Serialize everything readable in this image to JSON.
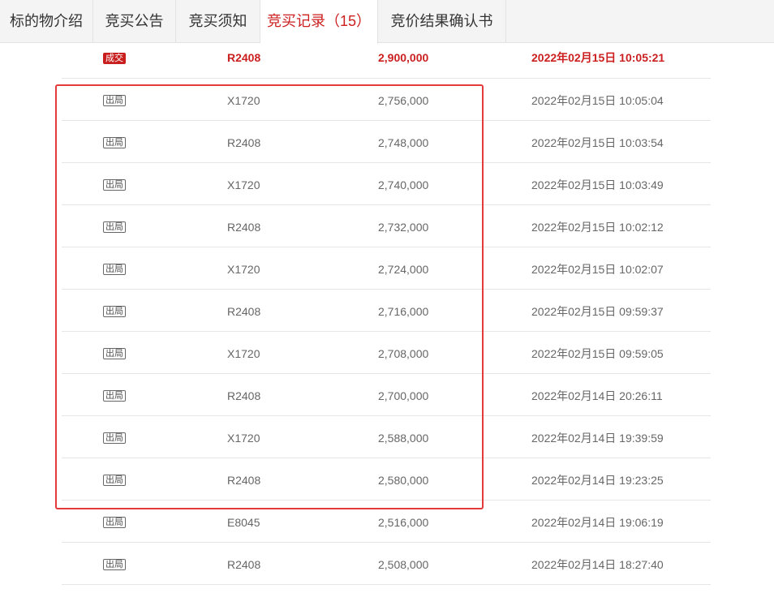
{
  "tabs": [
    {
      "label": "标的物介绍",
      "active": false
    },
    {
      "label": "竞买公告",
      "active": false
    },
    {
      "label": "竞买须知",
      "active": false
    },
    {
      "label": "竞买记录（15）",
      "active": true
    },
    {
      "label": "竞价结果确认书",
      "active": false
    }
  ],
  "records": [
    {
      "status": "成交",
      "bidder": "R2408",
      "price": "2,900,000",
      "time": "2022年02月15日 10:05:21"
    },
    {
      "status": "出局",
      "bidder": "X1720",
      "price": "2,756,000",
      "time": "2022年02月15日 10:05:04"
    },
    {
      "status": "出局",
      "bidder": "R2408",
      "price": "2,748,000",
      "time": "2022年02月15日 10:03:54"
    },
    {
      "status": "出局",
      "bidder": "X1720",
      "price": "2,740,000",
      "time": "2022年02月15日 10:03:49"
    },
    {
      "status": "出局",
      "bidder": "R2408",
      "price": "2,732,000",
      "time": "2022年02月15日 10:02:12"
    },
    {
      "status": "出局",
      "bidder": "X1720",
      "price": "2,724,000",
      "time": "2022年02月15日 10:02:07"
    },
    {
      "status": "出局",
      "bidder": "R2408",
      "price": "2,716,000",
      "time": "2022年02月15日 09:59:37"
    },
    {
      "status": "出局",
      "bidder": "X1720",
      "price": "2,708,000",
      "time": "2022年02月15日 09:59:05"
    },
    {
      "status": "出局",
      "bidder": "R2408",
      "price": "2,700,000",
      "time": "2022年02月14日 20:26:11"
    },
    {
      "status": "出局",
      "bidder": "X1720",
      "price": "2,588,000",
      "time": "2022年02月14日 19:39:59"
    },
    {
      "status": "出局",
      "bidder": "R2408",
      "price": "2,580,000",
      "time": "2022年02月14日 19:23:25"
    },
    {
      "status": "出局",
      "bidder": "E8045",
      "price": "2,516,000",
      "time": "2022年02月14日 19:06:19"
    },
    {
      "status": "出局",
      "bidder": "R2408",
      "price": "2,508,000",
      "time": "2022年02月14日 18:27:40"
    }
  ],
  "colors": {
    "accent": "#cc1f1f",
    "highlight_border": "#e53a3a"
  }
}
